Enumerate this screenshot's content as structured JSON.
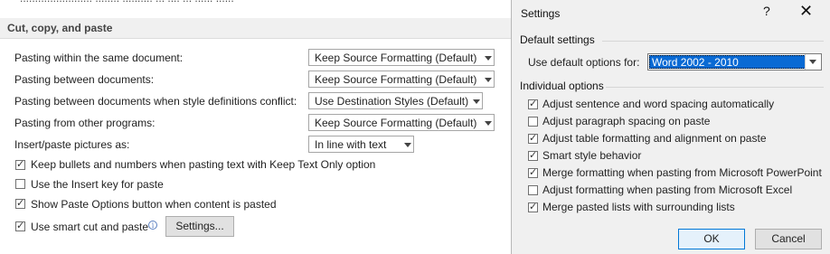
{
  "top_partial_text": "........................ ........ .......... ... .... ... ...... ......",
  "section": {
    "title": "Cut, copy, and paste"
  },
  "rows": [
    {
      "label": "Pasting within the same document:",
      "value": "Keep Source Formatting (Default)"
    },
    {
      "label": "Pasting between documents:",
      "value": "Keep Source Formatting (Default)"
    },
    {
      "label": "Pasting between documents when style definitions conflict:",
      "value": "Use Destination Styles (Default)"
    },
    {
      "label": "Pasting from other programs:",
      "value": "Keep Source Formatting (Default)"
    },
    {
      "label": "Insert/paste pictures as:",
      "value": "In line with text"
    }
  ],
  "options": [
    {
      "label": "Keep bullets and numbers when pasting text with Keep Text Only option",
      "checked": true
    },
    {
      "label": "Use the Insert key for paste",
      "checked": false
    },
    {
      "label": "Show Paste Options button when content is pasted",
      "checked": true
    },
    {
      "label": "Use smart cut and paste",
      "checked": true
    }
  ],
  "info_icon": "info-icon",
  "settings_button": "Settings...",
  "dialog": {
    "title": "Settings",
    "help": "?",
    "close": "✕",
    "default_group": "Default settings",
    "use_default_label": "Use default options for:",
    "use_default_value": "Word 2002 - 2010",
    "individual_group": "Individual options",
    "items": [
      {
        "label": "Adjust sentence and word spacing automatically",
        "checked": true
      },
      {
        "label": "Adjust paragraph spacing on paste",
        "checked": false
      },
      {
        "label": "Adjust table formatting and alignment on paste",
        "checked": true
      },
      {
        "label": "Smart style behavior",
        "checked": true
      },
      {
        "label": "Merge formatting when pasting from Microsoft PowerPoint",
        "checked": true
      },
      {
        "label": "Adjust formatting when pasting from Microsoft Excel",
        "checked": false
      },
      {
        "label": "Merge pasted lists with surrounding lists",
        "checked": true
      }
    ],
    "ok": "OK",
    "cancel": "Cancel"
  },
  "colors": {
    "accent": "#0a6ad4",
    "dialog_bg": "#f0f0f0",
    "header_bg": "#f0f0f0"
  }
}
